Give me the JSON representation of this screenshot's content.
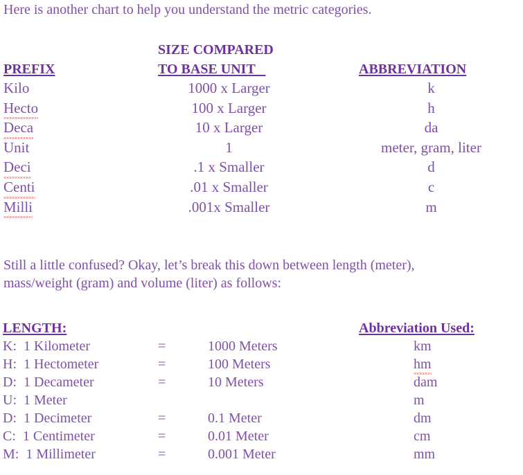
{
  "intro": {
    "text": "Here is another chart to help you understand the metric categories."
  },
  "colors": {
    "heading_purple": "#7030a0",
    "body_purple": "#8050a8",
    "spellcheck_red": "#e02020",
    "background": "#ffffff"
  },
  "prefix_table": {
    "headers": {
      "col1": "PREFIX",
      "col2_line1": "SIZE COMPARED",
      "col2_line2": "TO BASE UNIT   ",
      "col3": "ABBREVIATION"
    },
    "rows": [
      {
        "prefix": "Kilo",
        "size": "1000 x Larger",
        "abbr": "k",
        "misspelled": false
      },
      {
        "prefix": "Hecto",
        "size": "100 x Larger",
        "abbr": "h",
        "misspelled": true
      },
      {
        "prefix": "Deca",
        "size": "10 x Larger",
        "abbr": "da",
        "misspelled": true
      },
      {
        "prefix": "Unit",
        "size": "1",
        "abbr": "meter, gram,  liter",
        "misspelled": false
      },
      {
        "prefix": "Deci",
        "size": ".1 x Smaller",
        "abbr": "d",
        "misspelled": true
      },
      {
        "prefix": "Centi",
        "size": ".01 x Smaller",
        "abbr": "c",
        "misspelled": true
      },
      {
        "prefix": "Milli",
        "size": ".001x Smaller",
        "abbr": "m",
        "misspelled": true
      }
    ]
  },
  "explanation": {
    "line1": "Still a little confused?  Okay, let’s break this down between length (meter),",
    "line2": "mass/weight (gram)  and volume (liter) as follows:"
  },
  "length_table": {
    "headers": {
      "left": "LENGTH:",
      "right": "Abbreviation Used:"
    },
    "rows": [
      {
        "name": "K:  1 Kilometer",
        "eq": "=",
        "value": "1000 Meters",
        "abbr": "km",
        "abbr_misspelled": false
      },
      {
        "name": "H:  1 Hectometer",
        "eq": "=",
        "value": "100 Meters",
        "abbr": "hm",
        "abbr_misspelled": true
      },
      {
        "name": "D:  1 Decameter",
        "eq": "=",
        "value": "10 Meters",
        "abbr": "dam",
        "abbr_misspelled": false
      },
      {
        "name": "U:  1 Meter",
        "eq": "",
        "value": "",
        "abbr": "m",
        "abbr_misspelled": false
      },
      {
        "name": "D:  1 Decimeter",
        "eq": "=",
        "value": "0.1 Meter",
        "abbr": "dm",
        "abbr_misspelled": false
      },
      {
        "name": "C:  1 Centimeter",
        "eq": "=",
        "value": "0.01 Meter",
        "abbr": "cm",
        "abbr_misspelled": false
      },
      {
        "name": "M:  1 Millimeter",
        "eq": "=",
        "value": "0.001 Meter",
        "abbr": "mm",
        "abbr_misspelled": false
      }
    ]
  }
}
